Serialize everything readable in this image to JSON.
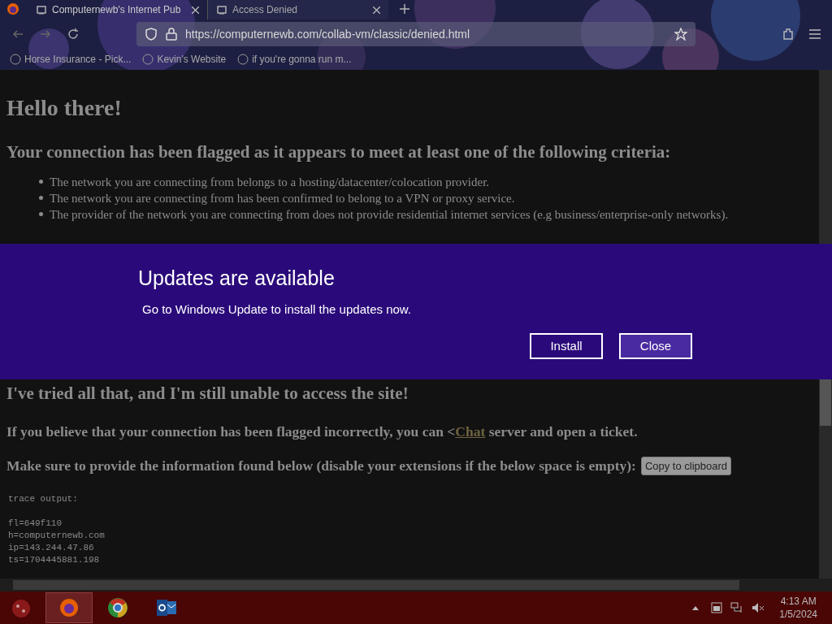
{
  "browser": {
    "tabs": [
      {
        "title": "Computernewb's Internet Pub",
        "selected": false
      },
      {
        "title": "Access Denied",
        "selected": true
      }
    ],
    "url": "https://computernewb.com/collab-vm/classic/denied.html",
    "bookmarks": [
      "Horse Insurance - Pick...",
      "Kevin's Website",
      "if you're gonna run m..."
    ]
  },
  "page": {
    "title": "Hello there!",
    "criteria_heading": "Your connection has been flagged as it appears to meet at least one of the following criteria:",
    "criteria": [
      "The network you are connecting from belongs to a hosting/datacenter/colocation provider.",
      "The network you are connecting from has been confirmed to belong to a VPN or proxy service.",
      "The provider of the network you are connecting from does not provide residential internet services (e.g business/enterprise-only networks)."
    ],
    "still_heading": "I've tried all that, and I'm still unable to access the site!",
    "ticket_before": "If you believe that your connection has been flagged incorrectly, you can <",
    "ticket_link": "Chat",
    "ticket_after": "server and open a ticket.",
    "provide_text": "Make sure to provide the information found below (disable your extensions if the below space is empty):",
    "copy_button": "Copy to clipboard",
    "trace_label": "trace output:",
    "trace_lines": [
      "fl=649f110",
      "h=computernewb.com",
      "ip=143.244.47.86",
      "ts=1704445881.198"
    ]
  },
  "notification": {
    "title": "Updates are available",
    "message": "Go to Windows Update to install the updates now.",
    "buttons": [
      {
        "label": "Install",
        "kind": "secondary"
      },
      {
        "label": "Close",
        "kind": "primary"
      }
    ]
  },
  "taskbar": {
    "apps": [
      {
        "kind": "firefox",
        "selected": true
      },
      {
        "kind": "chrome",
        "selected": false
      },
      {
        "kind": "outlook",
        "selected": false
      }
    ],
    "time": "4:13 AM",
    "date": "1/5/2024"
  }
}
